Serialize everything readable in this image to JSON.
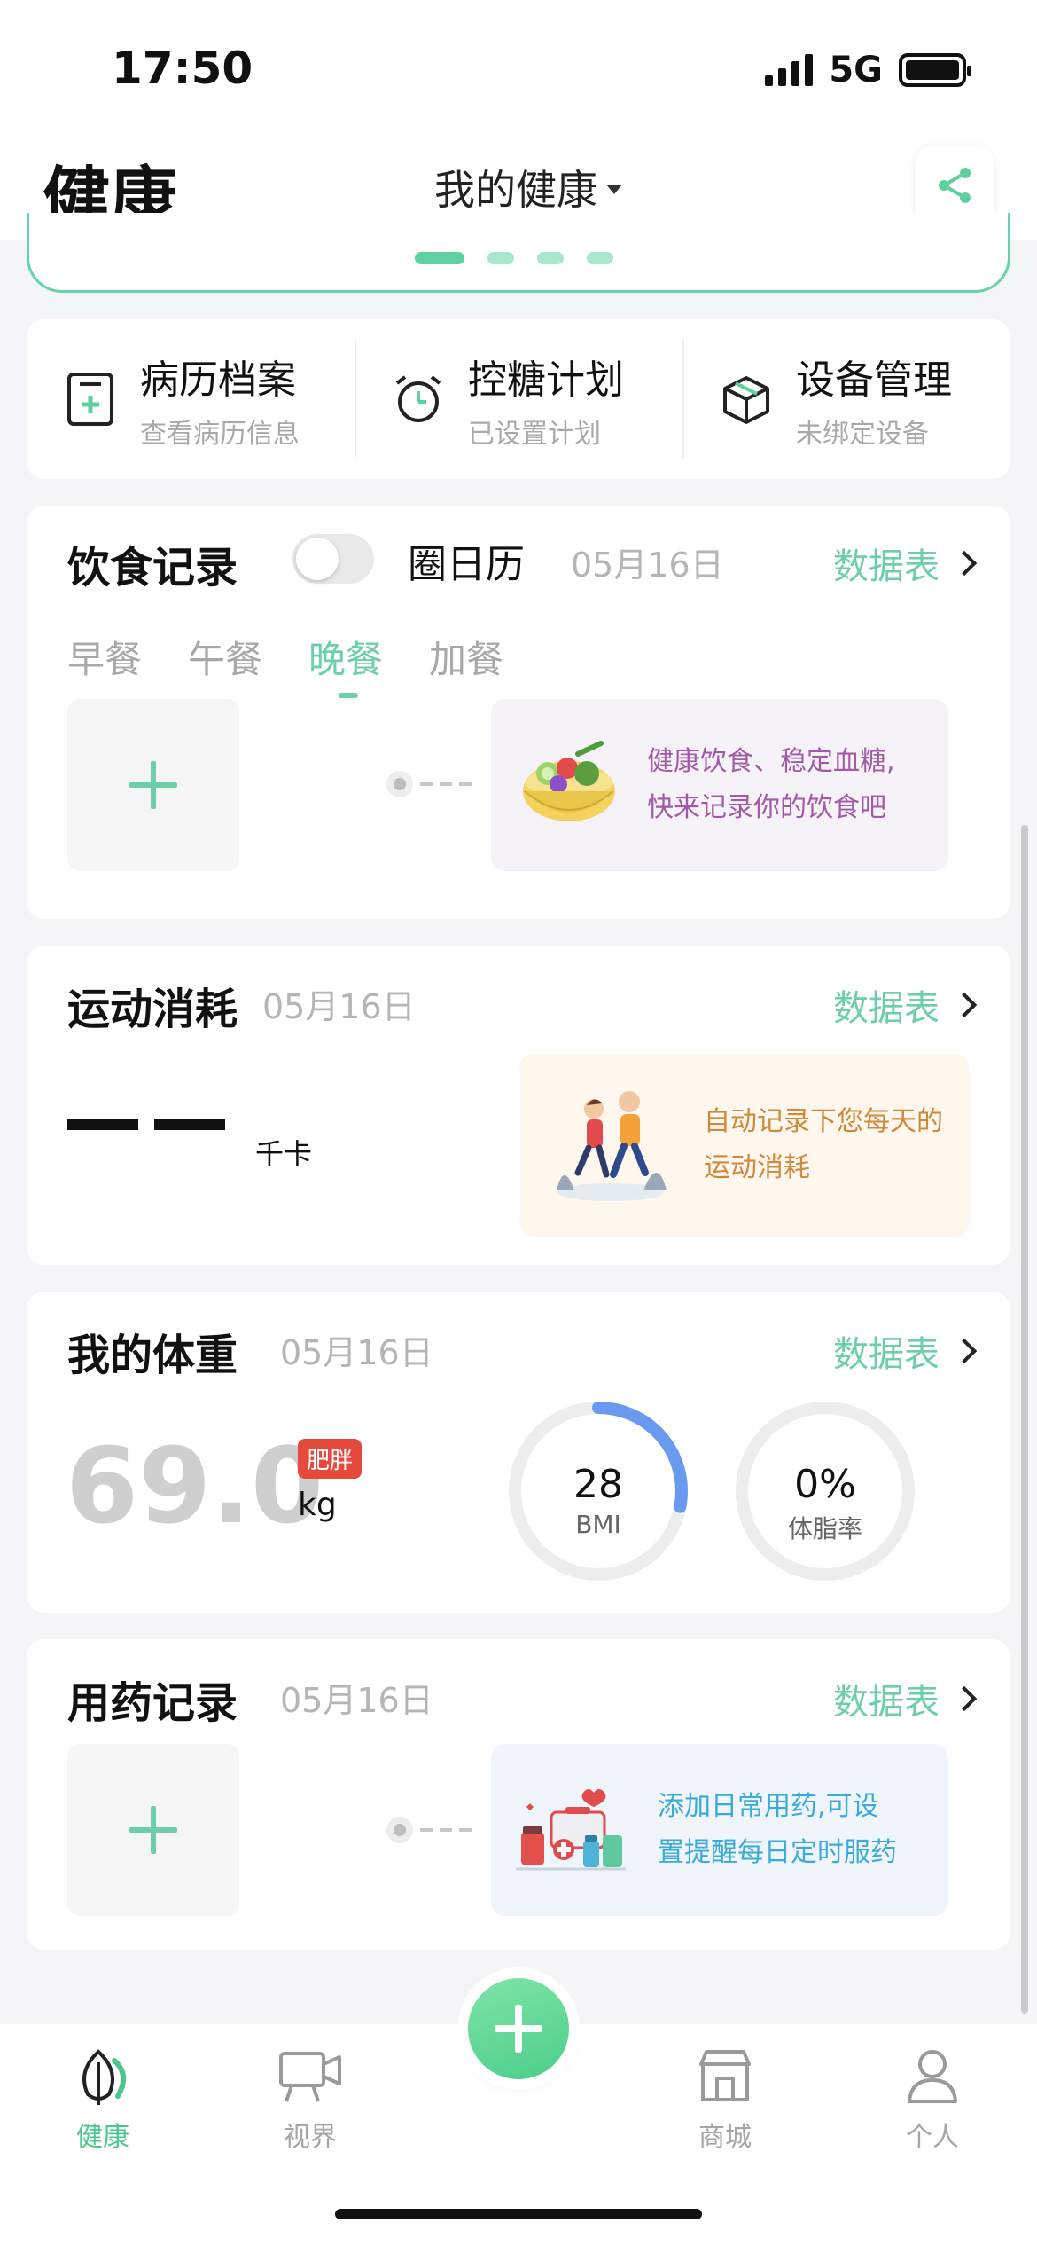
{
  "status_bar": {
    "time": "17:50",
    "network": "5G"
  },
  "header": {
    "brand": "健康",
    "title": "我的健康"
  },
  "quick_links": [
    {
      "title": "病历档案",
      "subtitle": "查看病历信息",
      "icon": "medical-record-icon"
    },
    {
      "title": "控糖计划",
      "subtitle": "已设置计划",
      "icon": "alarm-clock-icon"
    },
    {
      "title": "设备管理",
      "subtitle": "未绑定设备",
      "icon": "device-box-icon"
    }
  ],
  "diet": {
    "title": "饮食记录",
    "toggle_label": "圈日历",
    "date": "05月16日",
    "data_link": "数据表",
    "tabs": [
      "早餐",
      "午餐",
      "晚餐",
      "加餐"
    ],
    "active_tab": "晚餐",
    "hint_line1": "健康饮食、稳定血糖,",
    "hint_line2": "快来记录你的饮食吧"
  },
  "exercise": {
    "title": "运动消耗",
    "date": "05月16日",
    "data_link": "数据表",
    "unit": "千卡",
    "hint_line1": "自动记录下您每天的",
    "hint_line2": "运动消耗"
  },
  "weight": {
    "title": "我的体重",
    "date": "05月16日",
    "data_link": "数据表",
    "value": "69.0",
    "badge": "肥胖",
    "unit": "kg",
    "bmi_value": "28",
    "bmi_label": "BMI",
    "bmi_progress": 0.28,
    "fat_value": "0%",
    "fat_label": "体脂率",
    "fat_progress": 0
  },
  "medication": {
    "title": "用药记录",
    "date": "05月16日",
    "data_link": "数据表",
    "hint_line1": "添加日常用药,可设",
    "hint_line2": "置提醒每日定时服药"
  },
  "tabbar": {
    "items": [
      {
        "label": "健康",
        "icon": "leaf-icon",
        "active": true
      },
      {
        "label": "视界",
        "icon": "video-camera-icon",
        "active": false
      },
      {
        "label": "商城",
        "icon": "store-icon",
        "active": false
      },
      {
        "label": "个人",
        "icon": "person-icon",
        "active": false
      }
    ]
  },
  "colors": {
    "accent": "#6ccfa8",
    "badge": "#e64a3d",
    "bmi_ring": "#6a9af0",
    "diet_hint_text": "#a05aa8",
    "exercise_hint_text": "#d0883a",
    "medication_hint_text": "#3aaad8"
  }
}
